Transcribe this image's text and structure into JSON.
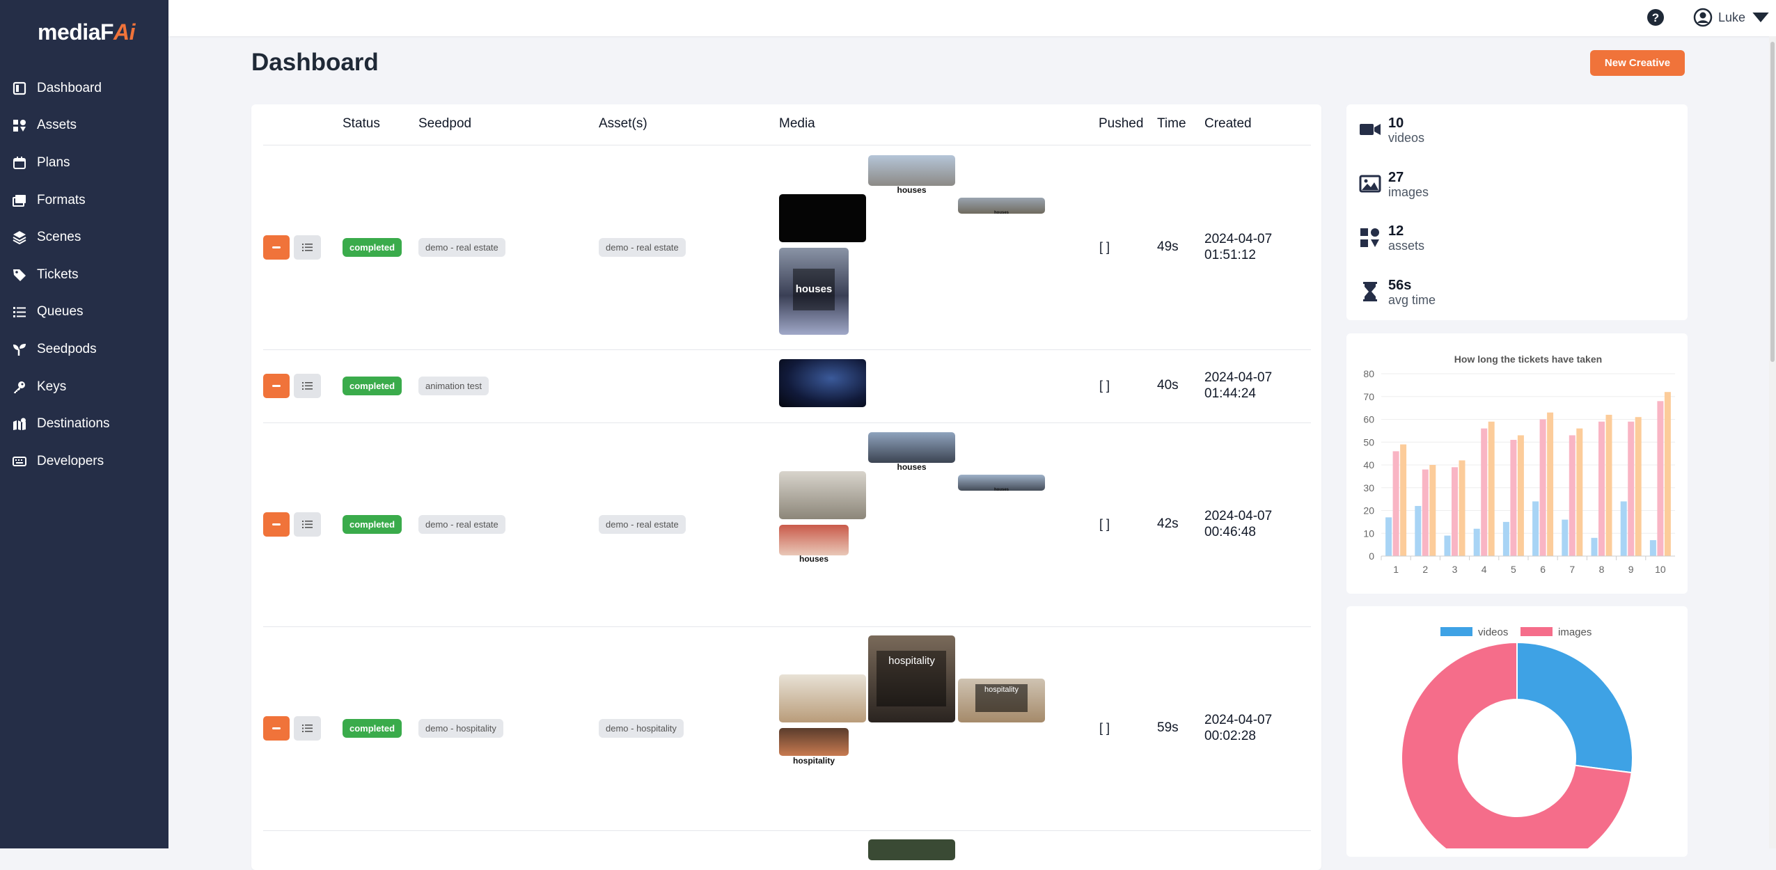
{
  "app": {
    "logo_main": "mediaF",
    "logo_accent": "Ai"
  },
  "sidebar": {
    "items": [
      {
        "label": "Dashboard",
        "icon": "dashboard-icon"
      },
      {
        "label": "Assets",
        "icon": "assets-icon"
      },
      {
        "label": "Plans",
        "icon": "calendar-icon"
      },
      {
        "label": "Formats",
        "icon": "formats-icon"
      },
      {
        "label": "Scenes",
        "icon": "layers-icon"
      },
      {
        "label": "Tickets",
        "icon": "tag-icon"
      },
      {
        "label": "Queues",
        "icon": "list-icon"
      },
      {
        "label": "Seedpods",
        "icon": "seedling-icon"
      },
      {
        "label": "Keys",
        "icon": "key-icon"
      },
      {
        "label": "Destinations",
        "icon": "map-icon"
      },
      {
        "label": "Developers",
        "icon": "keyboard-icon"
      }
    ]
  },
  "header": {
    "user_name": "Luke"
  },
  "page": {
    "title": "Dashboard",
    "new_button": "New Creative"
  },
  "table": {
    "columns": [
      "Status",
      "Seedpod",
      "Asset(s)",
      "Media",
      "Pushed",
      "Time",
      "Created"
    ],
    "rows": [
      {
        "status": "completed",
        "seedpod": "demo - real estate",
        "assets": "demo - real estate",
        "pushed": "[ ]",
        "time": "49s",
        "created_date": "2024-04-07",
        "created_time": "01:51:12",
        "captions": [
          "houses",
          "houses",
          "houses"
        ]
      },
      {
        "status": "completed",
        "seedpod": "animation test",
        "assets": "",
        "pushed": "[ ]",
        "time": "40s",
        "created_date": "2024-04-07",
        "created_time": "01:44:24",
        "captions": []
      },
      {
        "status": "completed",
        "seedpod": "demo - real estate",
        "assets": "demo - real estate",
        "pushed": "[ ]",
        "time": "42s",
        "created_date": "2024-04-07",
        "created_time": "00:46:48",
        "captions": [
          "houses",
          "houses",
          "houses"
        ]
      },
      {
        "status": "completed",
        "seedpod": "demo - hospitality",
        "assets": "demo - hospitality",
        "pushed": "[ ]",
        "time": "59s",
        "created_date": "2024-04-07",
        "created_time": "00:02:28",
        "captions": [
          "hospitality",
          "hospitality",
          "hospitality"
        ]
      }
    ]
  },
  "stats": [
    {
      "value": "10",
      "label": "videos",
      "icon": "video-icon"
    },
    {
      "value": "27",
      "label": "images",
      "icon": "image-icon"
    },
    {
      "value": "12",
      "label": "assets",
      "icon": "assets-icon"
    },
    {
      "value": "56s",
      "label": "avg time",
      "icon": "hourglass-icon"
    }
  ],
  "chart_data": [
    {
      "type": "bar",
      "title": "How long the tickets have taken",
      "categories": [
        "1",
        "2",
        "3",
        "4",
        "5",
        "6",
        "7",
        "8",
        "9",
        "10"
      ],
      "ylim": [
        0,
        80
      ],
      "yticks": [
        0,
        10,
        20,
        30,
        40,
        50,
        60,
        70,
        80
      ],
      "series": [
        {
          "values": [
            17,
            22,
            9,
            12,
            15,
            24,
            16,
            8,
            24,
            7
          ],
          "color": "#a8d4f5"
        },
        {
          "values": [
            46,
            38,
            39,
            56,
            51,
            60,
            53,
            59,
            59,
            68
          ],
          "color": "#f9b5c4"
        },
        {
          "values": [
            49,
            40,
            42,
            59,
            53,
            63,
            56,
            62,
            61,
            72
          ],
          "color": "#fccc9a"
        }
      ]
    },
    {
      "type": "pie",
      "legend": [
        "videos",
        "images"
      ],
      "values": [
        10,
        27
      ],
      "colors": [
        "#3ea2e5",
        "#f56d8a"
      ]
    }
  ]
}
